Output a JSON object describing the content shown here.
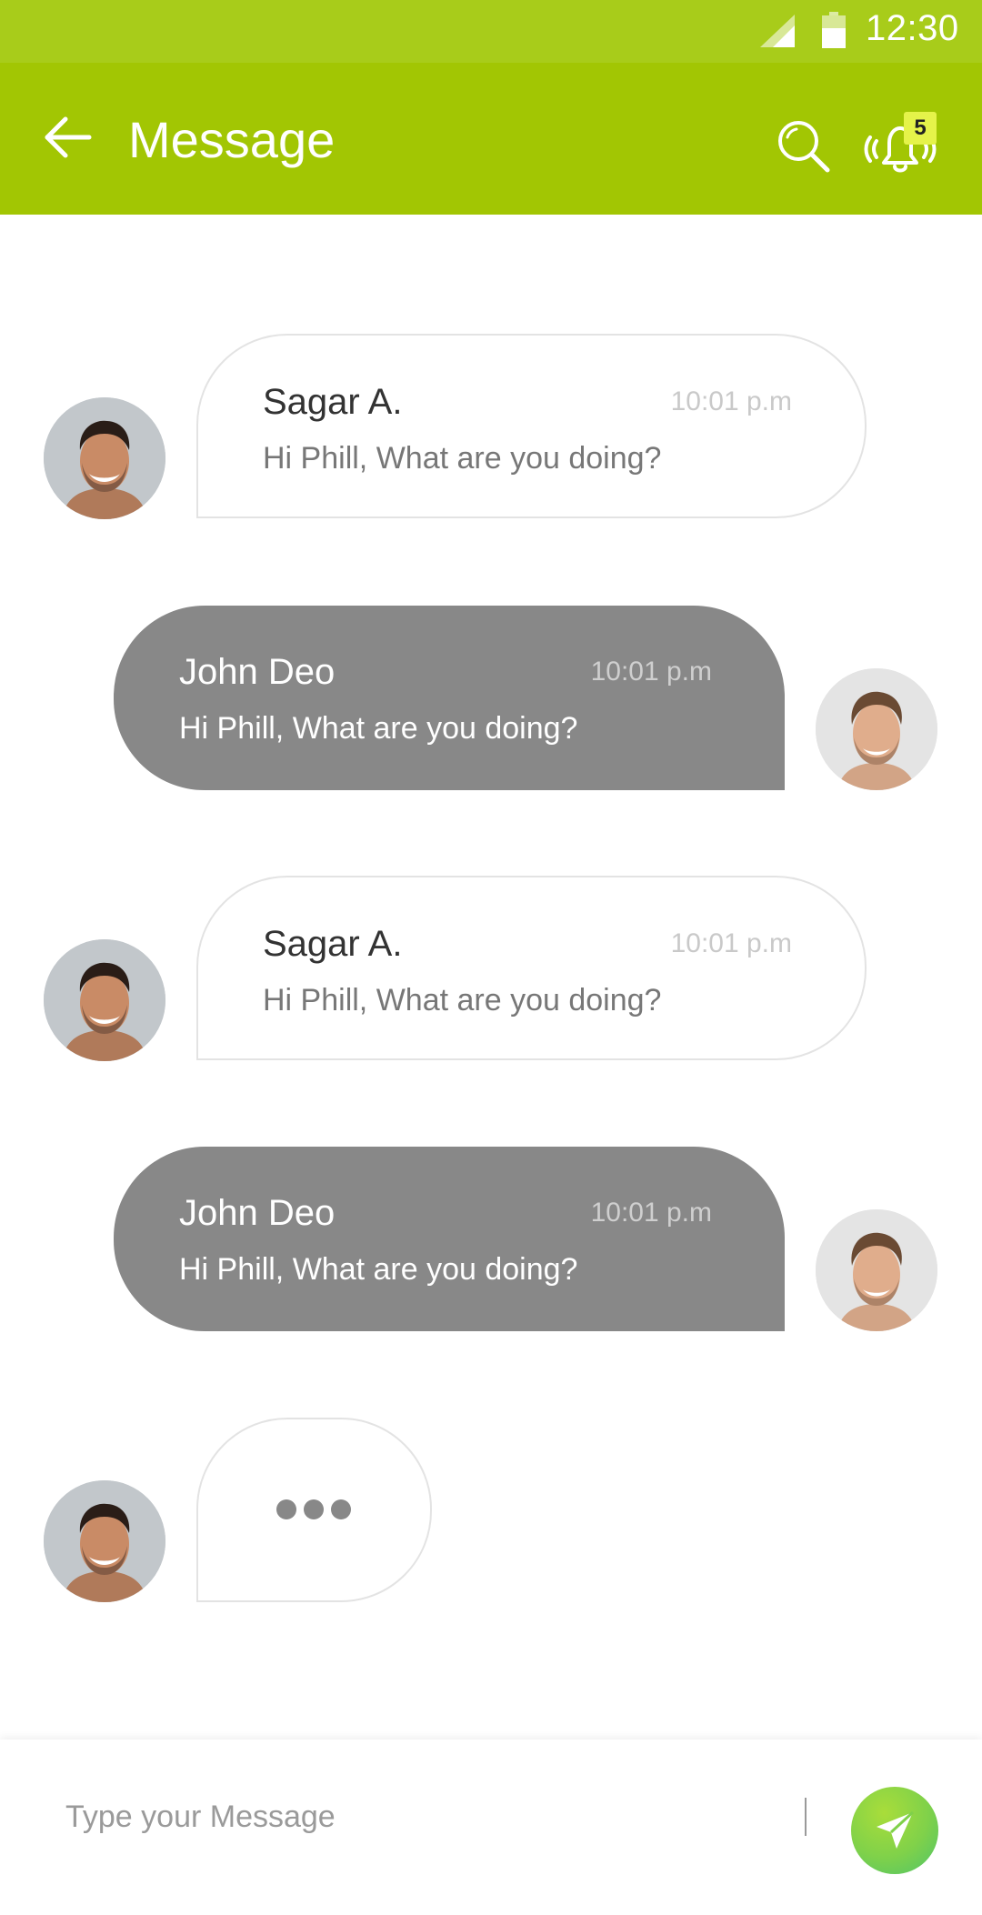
{
  "status_bar": {
    "time": "12:30"
  },
  "header": {
    "title": "Message",
    "notification_count": "5"
  },
  "colors": {
    "accent": "#a2c603",
    "status_bar": "#a8cc1a",
    "outgoing_bubble": "#888888",
    "badge": "#e5f34a",
    "send_button": "#7fd14a"
  },
  "icons": {
    "back": "arrow-left-icon",
    "search": "search-icon",
    "notifications": "bell-ringing-icon",
    "send": "paper-plane-icon"
  },
  "messages": [
    {
      "direction": "incoming",
      "sender": "Sagar A.",
      "time": "10:01 p.m",
      "text": "Hi Phill, What are you doing?"
    },
    {
      "direction": "outgoing",
      "sender": "John Deo",
      "time": "10:01 p.m",
      "text": "Hi Phill, What are you doing?"
    },
    {
      "direction": "incoming",
      "sender": "Sagar A.",
      "time": "10:01 p.m",
      "text": "Hi Phill, What are you doing?"
    },
    {
      "direction": "outgoing",
      "sender": "John Deo",
      "time": "10:01 p.m",
      "text": "Hi Phill, What are you doing?"
    }
  ],
  "composer": {
    "placeholder": "Type your Message",
    "value": ""
  }
}
